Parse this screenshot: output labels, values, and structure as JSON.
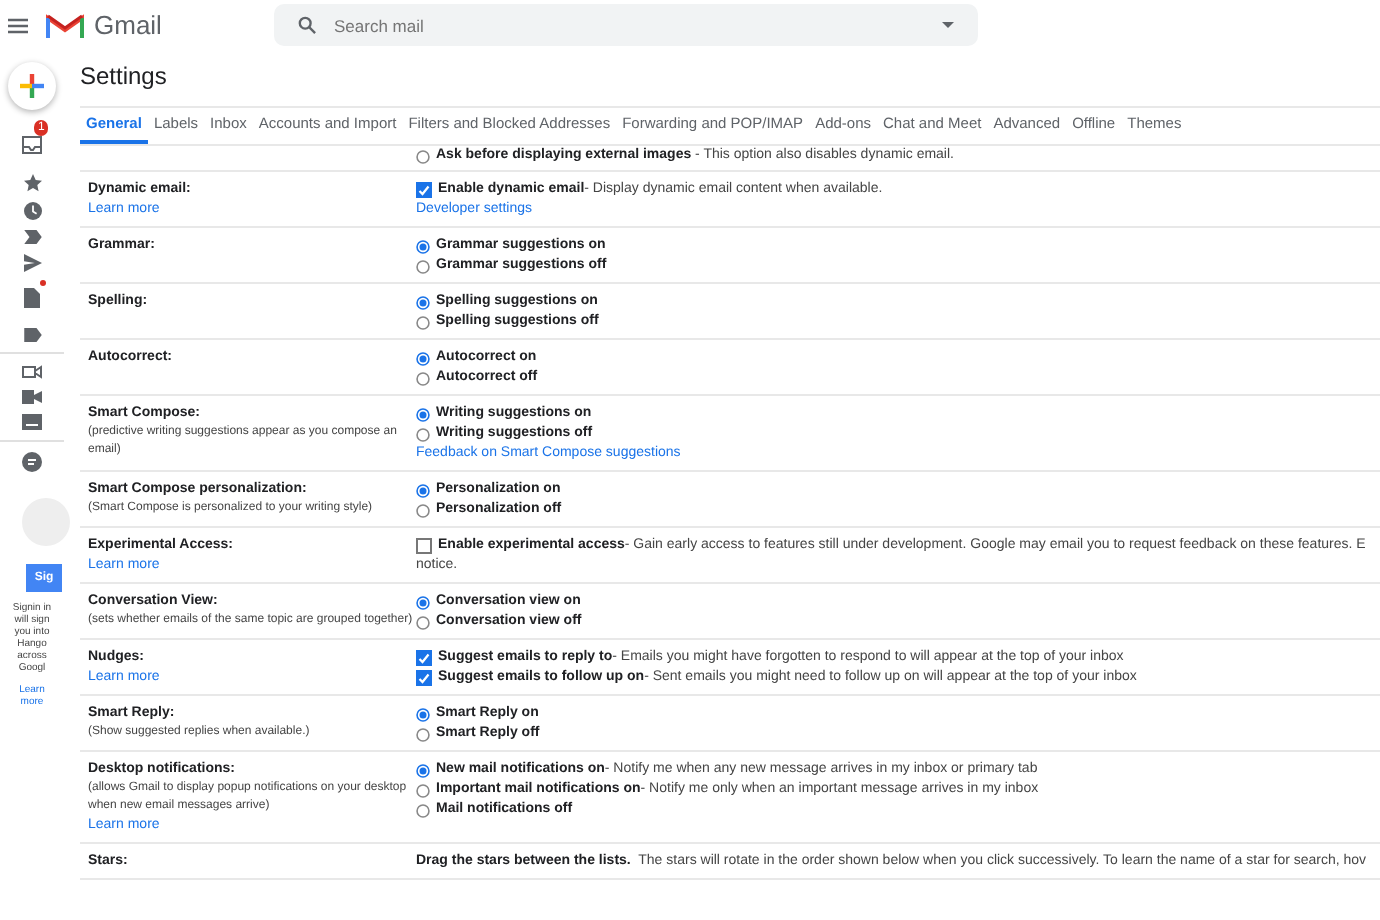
{
  "app": {
    "name": "Gmail"
  },
  "search": {
    "placeholder": "Search mail"
  },
  "rail": {
    "inbox_badge": "1",
    "sign_in_button": "Sig",
    "sign_in_text": "Signin in will sign you into Hango across Googl",
    "learn_more": "Learn more"
  },
  "page_title": "Settings",
  "tabs": [
    {
      "label": "General",
      "selected": true
    },
    {
      "label": "Labels",
      "selected": false
    },
    {
      "label": "Inbox",
      "selected": false
    },
    {
      "label": "Accounts and Import",
      "selected": false
    },
    {
      "label": "Filters and Blocked Addresses",
      "selected": false
    },
    {
      "label": "Forwarding and POP/IMAP",
      "selected": false
    },
    {
      "label": "Add-ons",
      "selected": false
    },
    {
      "label": "Chat and Meet",
      "selected": false
    },
    {
      "label": "Advanced",
      "selected": false
    },
    {
      "label": "Offline",
      "selected": false
    },
    {
      "label": "Themes",
      "selected": false
    }
  ],
  "top_option": {
    "kind": "radio",
    "label": "Ask before displaying external images",
    "description": "- This option also disables dynamic email.",
    "selected": false
  },
  "sections": [
    {
      "label": "Dynamic email:",
      "learn_more": "Learn more",
      "options": [
        {
          "kind": "checkbox",
          "label": "Enable dynamic email",
          "description": "- Display dynamic email content when available.",
          "checked": true
        }
      ],
      "link": "Developer settings"
    },
    {
      "label": "Grammar:",
      "options": [
        {
          "kind": "radio",
          "label": "Grammar suggestions on",
          "selected": true
        },
        {
          "kind": "radio",
          "label": "Grammar suggestions off",
          "selected": false
        }
      ]
    },
    {
      "label": "Spelling:",
      "options": [
        {
          "kind": "radio",
          "label": "Spelling suggestions on",
          "selected": true
        },
        {
          "kind": "radio",
          "label": "Spelling suggestions off",
          "selected": false
        }
      ]
    },
    {
      "label": "Autocorrect:",
      "options": [
        {
          "kind": "radio",
          "label": "Autocorrect on",
          "selected": true
        },
        {
          "kind": "radio",
          "label": "Autocorrect off",
          "selected": false
        }
      ]
    },
    {
      "label": "Smart Compose:",
      "note": "(predictive writing suggestions appear as you compose an email)",
      "options": [
        {
          "kind": "radio",
          "label": "Writing suggestions on",
          "selected": true
        },
        {
          "kind": "radio",
          "label": "Writing suggestions off",
          "selected": false
        }
      ],
      "link": "Feedback on Smart Compose suggestions"
    },
    {
      "label": "Smart Compose personalization:",
      "note": "(Smart Compose is personalized to your writing style)",
      "options": [
        {
          "kind": "radio",
          "label": "Personalization on",
          "selected": true
        },
        {
          "kind": "radio",
          "label": "Personalization off",
          "selected": false
        }
      ]
    },
    {
      "label": "Experimental Access:",
      "learn_more": "Learn more",
      "options": [
        {
          "kind": "checkbox",
          "label": "Enable experimental access",
          "description": "- Gain early access to features still under development. Google may email you to request feedback on these features. E",
          "continuation": "notice.",
          "checked": false
        }
      ]
    },
    {
      "label": "Conversation View:",
      "note": "(sets whether emails of the same topic are grouped together)",
      "options": [
        {
          "kind": "radio",
          "label": "Conversation view on",
          "selected": true
        },
        {
          "kind": "radio",
          "label": "Conversation view off",
          "selected": false
        }
      ]
    },
    {
      "label": "Nudges:",
      "learn_more": "Learn more",
      "options": [
        {
          "kind": "checkbox",
          "label": "Suggest emails to reply to",
          "description": "- Emails you might have forgotten to respond to will appear at the top of your inbox",
          "checked": true
        },
        {
          "kind": "checkbox",
          "label": "Suggest emails to follow up on",
          "description": "- Sent emails you might need to follow up on will appear at the top of your inbox",
          "checked": true
        }
      ]
    },
    {
      "label": "Smart Reply:",
      "note": "(Show suggested replies when available.)",
      "options": [
        {
          "kind": "radio",
          "label": "Smart Reply on",
          "selected": true
        },
        {
          "kind": "radio",
          "label": "Smart Reply off",
          "selected": false
        }
      ]
    },
    {
      "label": "Desktop notifications:",
      "note": "(allows Gmail to display popup notifications on your desktop when new email messages arrive)",
      "learn_more": "Learn more",
      "options": [
        {
          "kind": "radio",
          "label": "New mail notifications on",
          "description": "- Notify me when any new message arrives in my inbox or primary tab",
          "selected": true
        },
        {
          "kind": "radio",
          "label": "Important mail notifications on",
          "description": "- Notify me only when an important message arrives in my inbox",
          "selected": false
        },
        {
          "kind": "radio",
          "label": "Mail notifications off",
          "selected": false
        }
      ]
    },
    {
      "label": "Stars:",
      "options": [
        {
          "kind": "text",
          "label": "Drag the stars between the lists.",
          "description": "The stars will rotate in the order shown below when you click successively. To learn the name of a star for search, hov"
        }
      ]
    }
  ]
}
